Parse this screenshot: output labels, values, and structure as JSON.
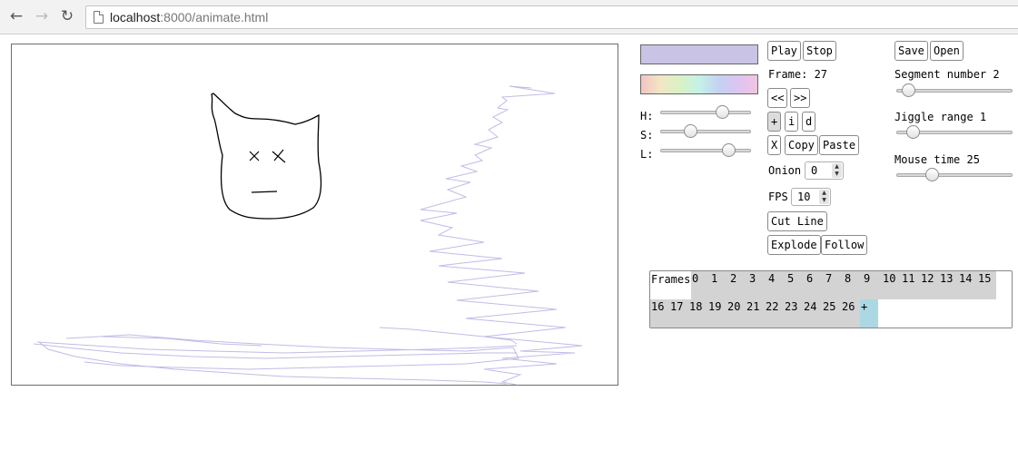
{
  "browser": {
    "back_icon": "arrow-left-icon",
    "forward_icon": "arrow-right-icon",
    "reload_icon": "reload-icon",
    "page_icon": "page-icon",
    "url_host": "localhost",
    "url_rest": ":8000/animate.html"
  },
  "colors": {
    "current_color": "#c9c3e6",
    "stroke_color": "#c2bbe6",
    "ink": "#000000",
    "frame_cell": "#d3d3d3",
    "add_frame_cell": "#acd8e4"
  },
  "hsl": {
    "h_label": "H:",
    "s_label": "S:",
    "l_label": "L:",
    "h_value": 0.72,
    "s_value": 0.3,
    "l_value": 0.8
  },
  "controls": {
    "play": "Play",
    "stop": "Stop",
    "frame_text": "Frame: 27",
    "prev": "<<",
    "next": ">>",
    "plus": "+",
    "insert": "i",
    "delete": "d",
    "clear": "X",
    "copy": "Copy",
    "paste": "Paste",
    "onion_label": "Onion",
    "onion_value": "0",
    "fps_label": "FPS",
    "fps_value": "10",
    "cut_line": "Cut Line",
    "explode": "Explode",
    "follow": "Follow",
    "spin_icon": "spinner-arrows-icon"
  },
  "right_panel": {
    "save": "Save",
    "open": "Open",
    "segment_label": "Segment number 2",
    "segment_value": 0.05,
    "jiggle_label": "Jiggle range 1",
    "jiggle_value": 0.1,
    "mouse_label": "Mouse time 25",
    "mouse_value": 0.28
  },
  "frames": {
    "label": "Frames",
    "row1": [
      "0",
      "1",
      "2",
      "3",
      "4",
      "5",
      "6",
      "7",
      "8",
      "9",
      "10",
      "11",
      "12",
      "13",
      "14",
      "15"
    ],
    "row2": [
      "16",
      "17",
      "18",
      "19",
      "20",
      "21",
      "22",
      "23",
      "24",
      "25",
      "26",
      "+"
    ]
  }
}
